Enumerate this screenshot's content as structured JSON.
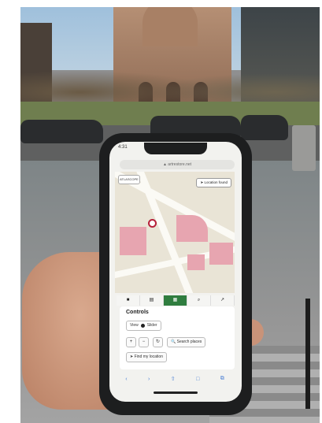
{
  "status": {
    "time": "4:31"
  },
  "browser": {
    "url": "▲ artrestore.net"
  },
  "map": {
    "logo_label": "ATLASCOPE",
    "location_button": "➤ Location found"
  },
  "toolbar": {
    "items": [
      "■",
      "▤",
      "▦",
      "⌕",
      "↗"
    ]
  },
  "controls": {
    "title": "Controls",
    "view_label": "View",
    "view_value": "Slider",
    "zoom_in": "+",
    "zoom_out": "−",
    "rotate": "↻",
    "search_places": "🔍 Search places",
    "find_my_location": "➤ Find my location"
  },
  "safari": {
    "items": [
      "‹",
      "›",
      "⇧",
      "□",
      "⧉"
    ]
  },
  "colors": {
    "accent": "#2f7d3f",
    "pin": "#b6203a",
    "block": "#e7a5b0"
  }
}
